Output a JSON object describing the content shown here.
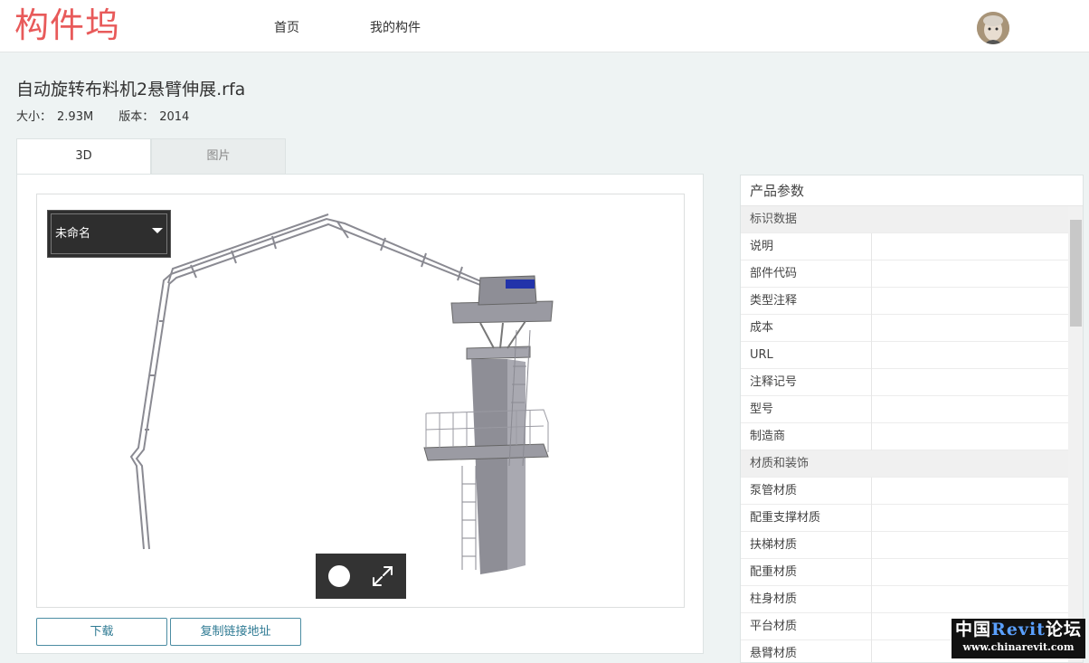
{
  "header": {
    "logo": "构件坞",
    "nav": [
      {
        "label": "首页"
      },
      {
        "label": "我的构件"
      }
    ]
  },
  "file": {
    "title": "自动旋转布料机2悬臂伸展.rfa",
    "size_label": "大小：",
    "size_value": "2.93M",
    "version_label": "版本：",
    "version_value": "2014"
  },
  "tabs": [
    {
      "label": "3D",
      "active": true
    },
    {
      "label": "图片",
      "active": false
    }
  ],
  "viewer": {
    "view_name": "未命名"
  },
  "actions": {
    "download": "下载",
    "copy_link": "复制链接地址"
  },
  "params": {
    "title": "产品参数",
    "rows": [
      {
        "type": "group",
        "label": "标识数据"
      },
      {
        "type": "row",
        "label": "说明",
        "value": ""
      },
      {
        "type": "row",
        "label": "部件代码",
        "value": ""
      },
      {
        "type": "row",
        "label": "类型注释",
        "value": ""
      },
      {
        "type": "row",
        "label": "成本",
        "value": ""
      },
      {
        "type": "row",
        "label": "URL",
        "value": ""
      },
      {
        "type": "row",
        "label": "注释记号",
        "value": ""
      },
      {
        "type": "row",
        "label": "型号",
        "value": ""
      },
      {
        "type": "row",
        "label": "制造商",
        "value": ""
      },
      {
        "type": "group",
        "label": "材质和装饰"
      },
      {
        "type": "row",
        "label": "泵管材质",
        "value": ""
      },
      {
        "type": "row",
        "label": "配重支撑材质",
        "value": ""
      },
      {
        "type": "row",
        "label": "扶梯材质",
        "value": ""
      },
      {
        "type": "row",
        "label": "配重材质",
        "value": ""
      },
      {
        "type": "row",
        "label": "柱身材质",
        "value": ""
      },
      {
        "type": "row",
        "label": "平台材质",
        "value": ""
      },
      {
        "type": "row",
        "label": "悬臂材质",
        "value": ""
      }
    ]
  },
  "watermark": {
    "line1_a": "中国",
    "line1_b": "Revit",
    "line1_c": "论坛",
    "line2": "www.chinarevit.com"
  },
  "colors": {
    "logo": "#e85a5a",
    "button_border": "#4c8da3",
    "background": "#eef3f3"
  }
}
